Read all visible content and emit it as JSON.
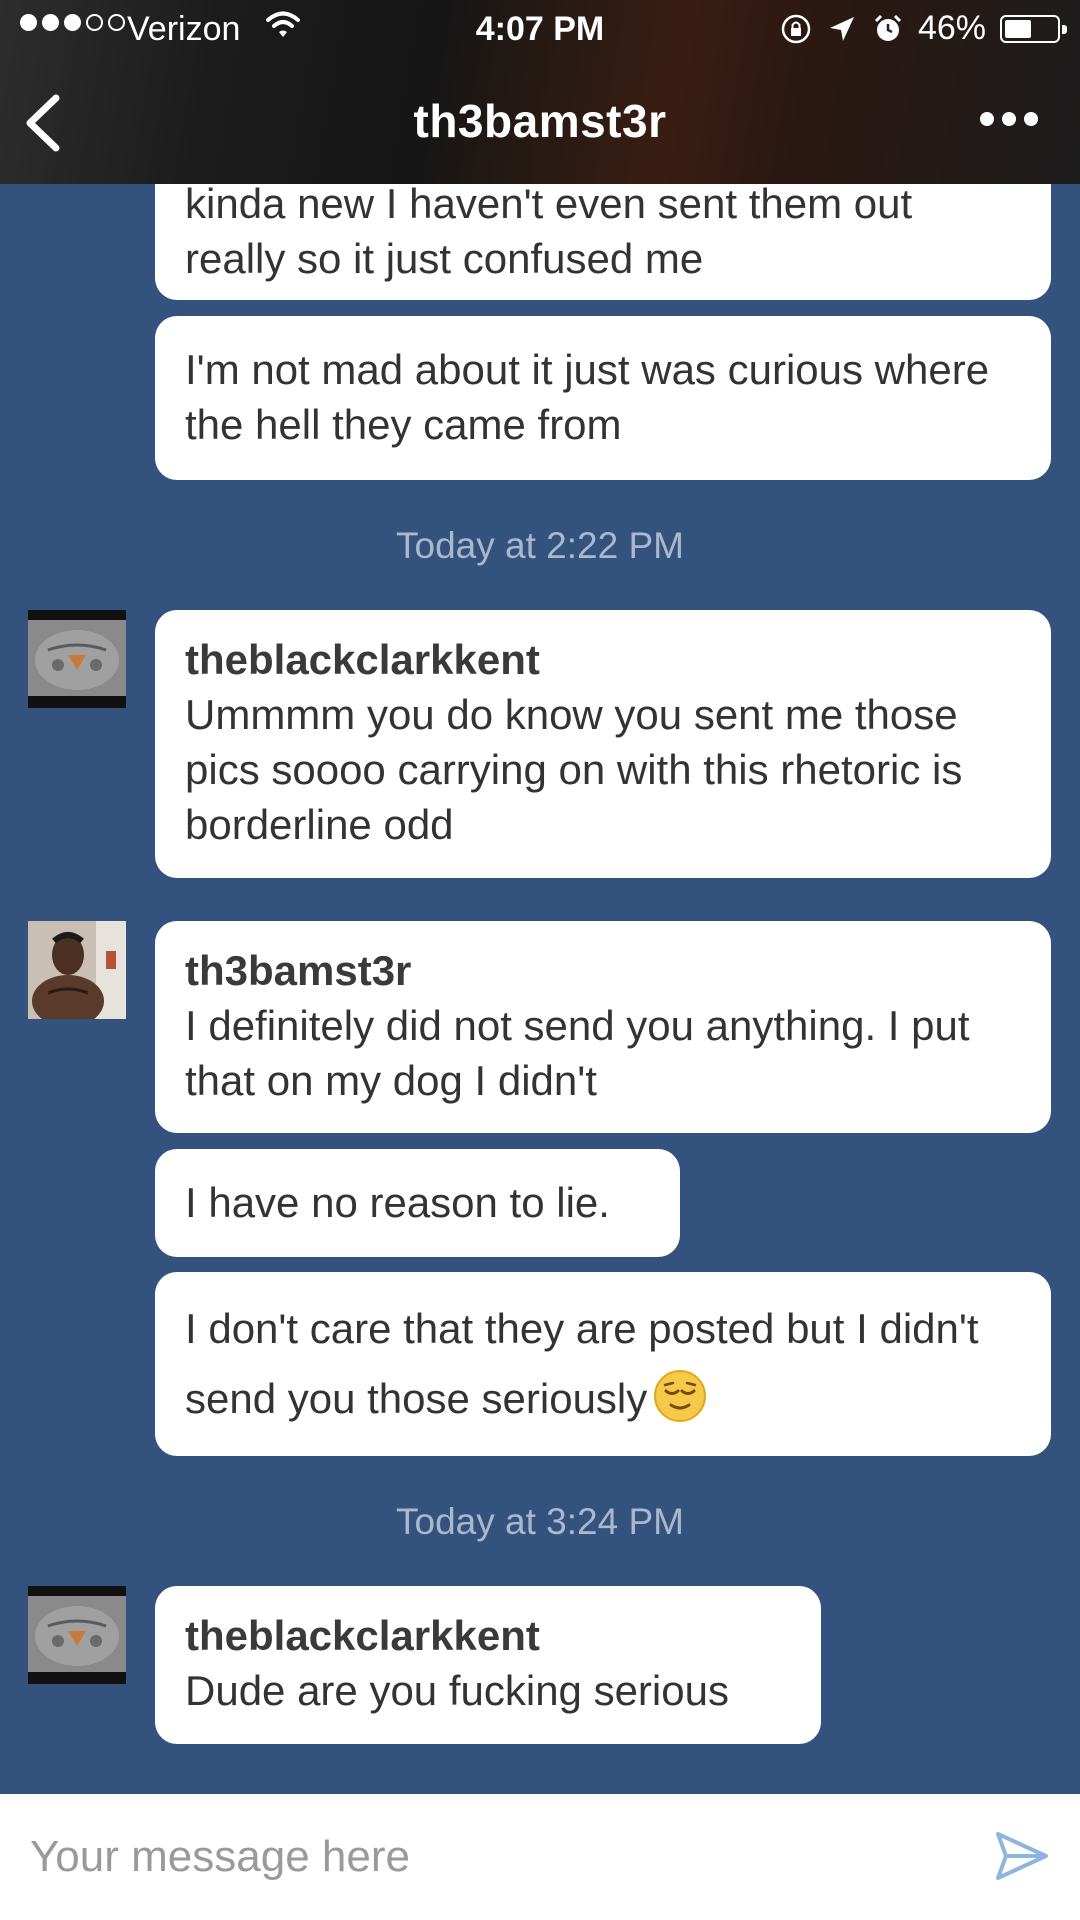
{
  "status_bar": {
    "carrier": "Verizon",
    "time": "4:07 PM",
    "battery": "46%",
    "battery_level": 0.46,
    "signal_bars": 3,
    "signal_total": 5
  },
  "nav": {
    "title": "th3bamst3r",
    "back_icon": "chevron-left-icon",
    "more_icon": "more-dots-icon"
  },
  "messages": [
    {
      "text": "kinda new I haven't even sent them out really so it just confused me"
    },
    {
      "text": "I'm not mad about it just was curious where the hell they came from"
    },
    {
      "timestamp": "Today at 2:22 PM"
    },
    {
      "sender": "theblackclarkkent",
      "text": "Ummmm you do know you sent me those pics soooo carrying on with this rhetoric is borderline odd"
    },
    {
      "sender": "th3bamst3r",
      "text": "I definitely did not send you anything. I put that on my dog I didn't"
    },
    {
      "text": "I have no reason to lie."
    },
    {
      "text": "I don't care that they are posted but I didn't send you those  seriously",
      "emoji": "relieved-face"
    },
    {
      "timestamp": "Today at 3:24 PM"
    },
    {
      "sender": "theblackclarkkent",
      "text": "Dude are you fucking serious"
    }
  ],
  "composer": {
    "placeholder": "Your message here",
    "send_icon": "send-icon"
  },
  "colors": {
    "background": "#34527e",
    "bubble": "#ffffff",
    "timestamp": "#a9b8cc",
    "send_icon": "#8fb4e0"
  }
}
